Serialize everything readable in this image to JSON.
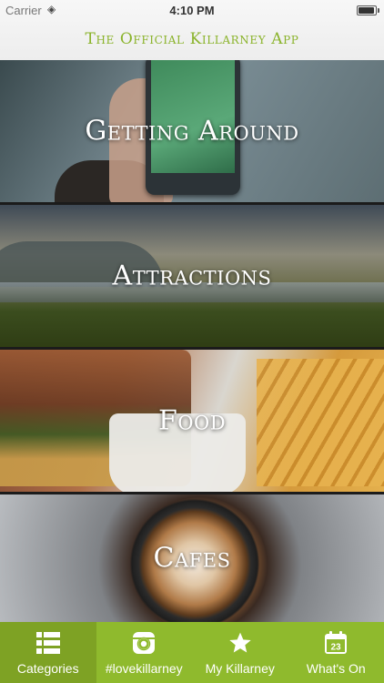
{
  "status_bar": {
    "carrier": "Carrier",
    "time": "4:10 PM",
    "battery_level": 0.95
  },
  "header": {
    "title": "The Official Killarney App"
  },
  "categories": [
    {
      "label": "Getting Around"
    },
    {
      "label": "Attractions"
    },
    {
      "label": "Food"
    },
    {
      "label": "Cafes"
    }
  ],
  "tabbar": {
    "accent_color": "#8fba2d",
    "active_index": 0,
    "tabs": [
      {
        "label": "Categories",
        "icon": "list-icon"
      },
      {
        "label": "#lovekillarney",
        "icon": "instagram-icon"
      },
      {
        "label": "My Killarney",
        "icon": "star-icon"
      },
      {
        "label": "What's On",
        "icon": "calendar-icon",
        "badge": "23"
      }
    ]
  }
}
